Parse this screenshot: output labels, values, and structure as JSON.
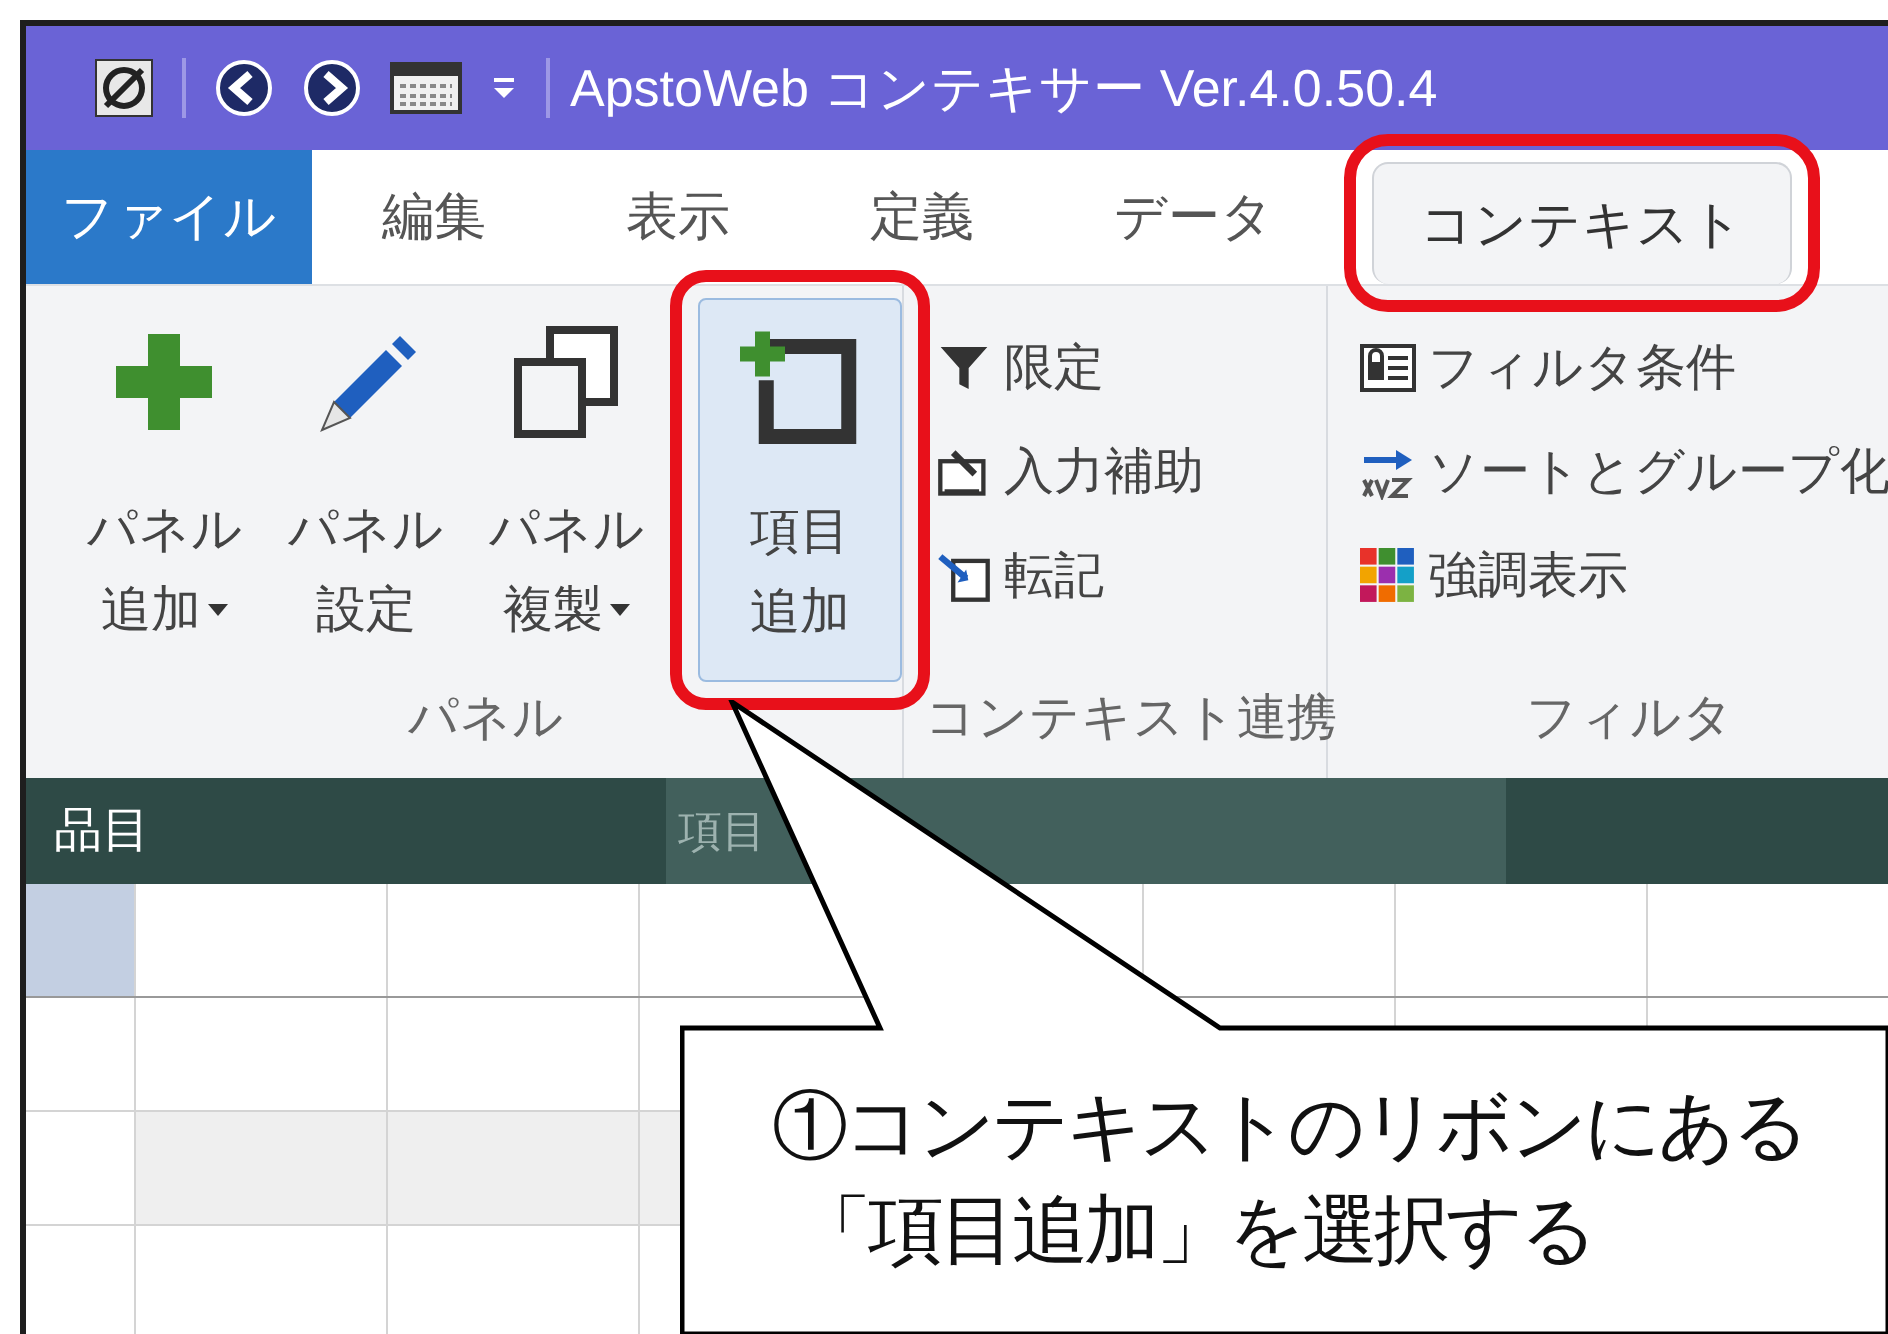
{
  "window": {
    "title": "ApstoWeb コンテキサー Ver.4.0.50.4"
  },
  "tabs": [
    {
      "label": "ファイル",
      "kind": "file",
      "selected": false,
      "highlighted": false
    },
    {
      "label": "編集",
      "kind": "tab",
      "selected": false,
      "highlighted": false
    },
    {
      "label": "表示",
      "kind": "tab",
      "selected": false,
      "highlighted": false
    },
    {
      "label": "定義",
      "kind": "tab",
      "selected": false,
      "highlighted": false
    },
    {
      "label": "データ",
      "kind": "tab",
      "selected": false,
      "highlighted": false
    },
    {
      "label": "コンテキスト",
      "kind": "tab",
      "selected": true,
      "highlighted": true
    }
  ],
  "ribbon_groups": [
    {
      "label": "パネル",
      "kind": "large",
      "buttons": [
        {
          "lines": [
            "パネル",
            "追加"
          ],
          "dropdown": true,
          "highlighted": false
        },
        {
          "lines": [
            "パネル",
            "設定"
          ],
          "dropdown": false,
          "highlighted": false
        },
        {
          "lines": [
            "パネル",
            "複製"
          ],
          "dropdown": true,
          "highlighted": false
        },
        {
          "lines": [
            "項目",
            "追加"
          ],
          "dropdown": false,
          "highlighted": true
        }
      ]
    },
    {
      "label": "コンテキスト連携",
      "kind": "small",
      "buttons": [
        {
          "label": "限定"
        },
        {
          "label": "入力補助"
        },
        {
          "label": "転記"
        }
      ]
    },
    {
      "label": "フィルタ",
      "kind": "small",
      "buttons": [
        {
          "label": "フィルタ条件"
        },
        {
          "label": "ソートとグループ化"
        },
        {
          "label": "強調表示"
        }
      ]
    }
  ],
  "panel": {
    "title": "品目",
    "drag_ghost": "項目"
  },
  "grid": {
    "rows": [
      {
        "selected": true,
        "shaded": false
      },
      {
        "selected": false,
        "shaded": false
      },
      {
        "selected": false,
        "shaded": true
      },
      {
        "selected": false,
        "shaded": false
      }
    ]
  },
  "annotation": {
    "lines": [
      "①コンテキストのリボンにある",
      "「項目追加」を選択する"
    ]
  }
}
